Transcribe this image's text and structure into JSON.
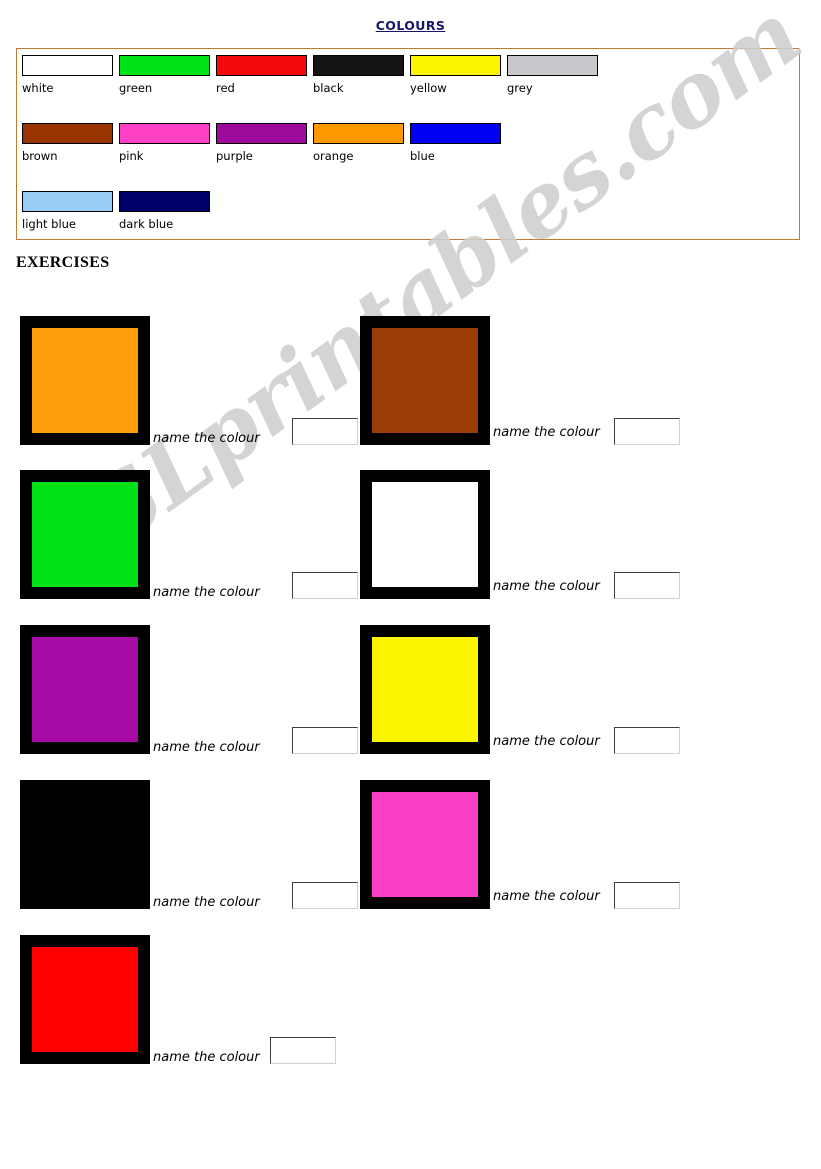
{
  "document": {
    "title": "COLOURS",
    "exercises_heading": "EXERCISES",
    "watermark": "ESLprintables.com",
    "watermark_color": "#cfcfcf",
    "legend_border_color": "#c07a32"
  },
  "legend": {
    "rows": [
      [
        {
          "label": "white",
          "color": "#ffffff"
        },
        {
          "label": "green",
          "color": "#00e218"
        },
        {
          "label": "red",
          "color": "#f40a0a"
        },
        {
          "label": "black",
          "color": "#141414"
        },
        {
          "label": "yellow",
          "color": "#fcf500"
        },
        {
          "label": "grey",
          "color": "#c8c8cc"
        }
      ],
      [
        {
          "label": "brown",
          "color": "#993300"
        },
        {
          "label": "pink",
          "color": "#ff3fc4"
        },
        {
          "label": "purple",
          "color": "#9c0a9c"
        },
        {
          "label": "orange",
          "color": "#ff9900"
        },
        {
          "label": "blue",
          "color": "#0000f5"
        }
      ],
      [
        {
          "label": "light blue",
          "color": "#99ccf5"
        },
        {
          "label": "dark blue",
          "color": "#00006b"
        }
      ]
    ]
  },
  "exercises": {
    "prompt": "name the colour",
    "answer_placeholder": "",
    "items": [
      {
        "color": "#ff9e0d",
        "answer": ""
      },
      {
        "color": "#9c3d08",
        "answer": ""
      },
      {
        "color": "#00e218",
        "answer": ""
      },
      {
        "color": "#ffffff",
        "answer": ""
      },
      {
        "color": "#a80aa8",
        "answer": ""
      },
      {
        "color": "#fcf500",
        "answer": ""
      },
      {
        "color": "#000000",
        "answer": ""
      },
      {
        "color": "#fa3fc4",
        "answer": ""
      },
      {
        "color": "#ff0000",
        "answer": ""
      }
    ]
  }
}
